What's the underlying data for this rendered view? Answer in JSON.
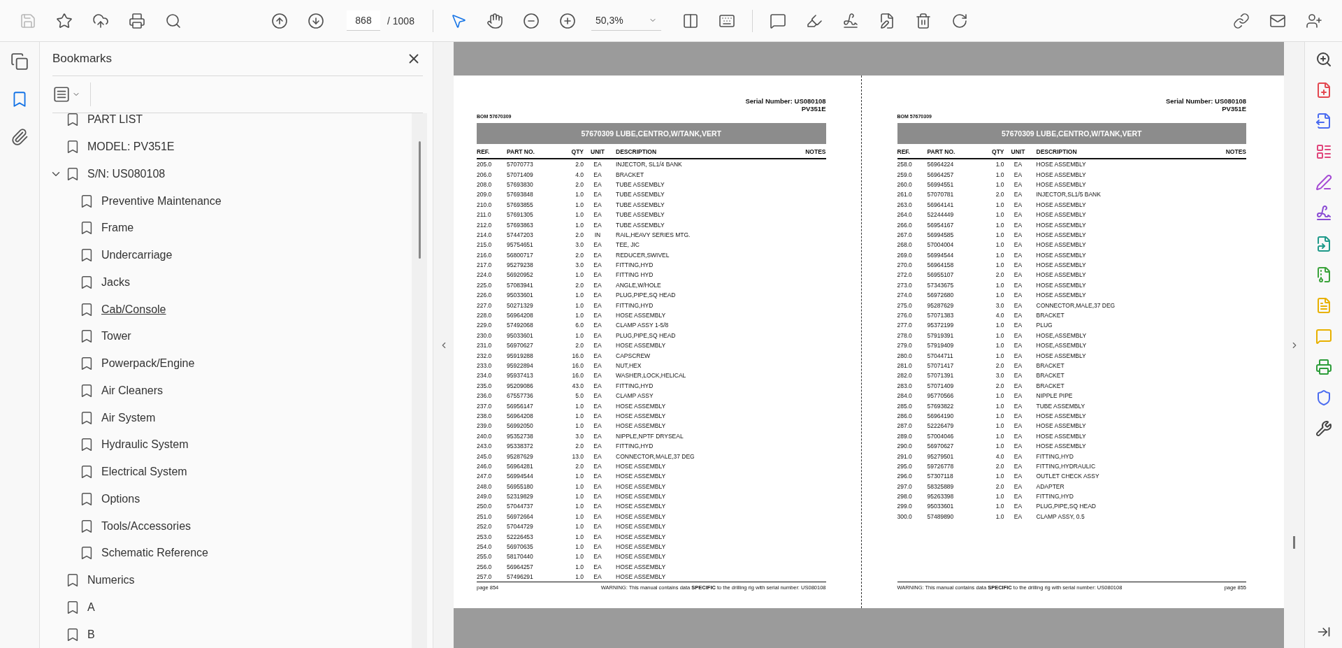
{
  "toolbar": {
    "save": {
      "disabled": true
    },
    "page_number": "868",
    "page_total": "/ 1008",
    "zoom": "50,3%",
    "tools": [
      {
        "kind": "select",
        "selected": true
      },
      {
        "kind": "hand",
        "selected": false
      }
    ]
  },
  "left_rail": [
    {
      "kind": "pages",
      "selected": false
    },
    {
      "kind": "bookmarks",
      "selected": true
    },
    {
      "kind": "attachments",
      "selected": false
    }
  ],
  "sidebar": {
    "title": "Bookmarks",
    "items": [
      {
        "label": "PART LIST",
        "hovered": false
      },
      {
        "label": "MODEL: PV351E",
        "hovered": false
      },
      {
        "label": "S/N: US080108",
        "hovered": false,
        "expanded": true,
        "children": [
          {
            "label": "Preventive Maintenance",
            "hovered": false
          },
          {
            "label": "Frame",
            "hovered": false
          },
          {
            "label": "Undercarriage",
            "hovered": false
          },
          {
            "label": "Jacks",
            "hovered": false
          },
          {
            "label": "Cab/Console",
            "hovered": true
          },
          {
            "label": "Tower",
            "hovered": false
          },
          {
            "label": "Powerpack/Engine",
            "hovered": false
          },
          {
            "label": "Air Cleaners",
            "hovered": false
          },
          {
            "label": "Air System",
            "hovered": false
          },
          {
            "label": "Hydraulic System",
            "hovered": false
          },
          {
            "label": "Electrical System",
            "hovered": false
          },
          {
            "label": "Options",
            "hovered": false
          },
          {
            "label": "Tools/Accessories",
            "hovered": false
          },
          {
            "label": "Schematic Reference",
            "hovered": false
          }
        ]
      },
      {
        "label": "Numerics",
        "hovered": false
      },
      {
        "label": "A",
        "hovered": false
      },
      {
        "label": "B",
        "hovered": false
      }
    ]
  },
  "pages": [
    {
      "serial": "Serial Number: US080108",
      "model": "PV351E",
      "bom": "BOM 57670309",
      "title": "57670309 LUBE,CENTRO,W/TANK,VERT",
      "columns": [
        "REF.",
        "PART NO.",
        "QTY",
        "UNIT",
        "DESCRIPTION",
        "NOTES"
      ],
      "rows": [
        [
          "205.0",
          "57070773",
          "2.0",
          "EA",
          "INJECTOR, SL1/4 BANK"
        ],
        [
          "206.0",
          "57071409",
          "4.0",
          "EA",
          "BRACKET"
        ],
        [
          "208.0",
          "57693830",
          "2.0",
          "EA",
          "TUBE ASSEMBLY"
        ],
        [
          "209.0",
          "57693848",
          "1.0",
          "EA",
          "TUBE ASSEMBLY"
        ],
        [
          "210.0",
          "57693855",
          "1.0",
          "EA",
          "TUBE ASSEMBLY"
        ],
        [
          "211.0",
          "57691305",
          "1.0",
          "EA",
          "TUBE ASSEMBLY"
        ],
        [
          "212.0",
          "57693863",
          "1.0",
          "EA",
          "TUBE ASSEMBLY"
        ],
        [
          "214.0",
          "57447203",
          "2.0",
          "IN",
          "RAIL,HEAVY SERIES MTG."
        ],
        [
          "215.0",
          "95754651",
          "3.0",
          "EA",
          "TEE, JIC"
        ],
        [
          "216.0",
          "56800717",
          "2.0",
          "EA",
          "REDUCER,SWIVEL"
        ],
        [
          "217.0",
          "95279238",
          "3.0",
          "EA",
          "FITTING,HYD"
        ],
        [
          "224.0",
          "56920952",
          "1.0",
          "EA",
          "FITTING HYD"
        ],
        [
          "225.0",
          "57083941",
          "2.0",
          "EA",
          "ANGLE,W/HOLE"
        ],
        [
          "226.0",
          "95033601",
          "1.0",
          "EA",
          "PLUG,PIPE,SQ HEAD"
        ],
        [
          "227.0",
          "50271329",
          "1.0",
          "EA",
          "FITTING,HYD"
        ],
        [
          "228.0",
          "56964208",
          "1.0",
          "EA",
          "HOSE ASSEMBLY"
        ],
        [
          "229.0",
          "57492068",
          "6.0",
          "EA",
          "CLAMP ASSY 1-5/8"
        ],
        [
          "230.0",
          "95033601",
          "1.0",
          "EA",
          "PLUG,PIPE,SQ HEAD"
        ],
        [
          "231.0",
          "56970627",
          "2.0",
          "EA",
          "HOSE ASSEMBLY"
        ],
        [
          "232.0",
          "95919288",
          "16.0",
          "EA",
          "CAPSCREW"
        ],
        [
          "233.0",
          "95922894",
          "16.0",
          "EA",
          "NUT,HEX"
        ],
        [
          "234.0",
          "95937413",
          "16.0",
          "EA",
          "WASHER,LOCK,HELICAL"
        ],
        [
          "235.0",
          "95209086",
          "43.0",
          "EA",
          "FITTING,HYD"
        ],
        [
          "236.0",
          "67557736",
          "5.0",
          "EA",
          "CLAMP ASSY"
        ],
        [
          "237.0",
          "56956147",
          "1.0",
          "EA",
          "HOSE ASSEMBLY"
        ],
        [
          "238.0",
          "56964208",
          "1.0",
          "EA",
          "HOSE ASSEMBLY"
        ],
        [
          "239.0",
          "56992050",
          "1.0",
          "EA",
          "HOSE ASSEMBLY"
        ],
        [
          "240.0",
          "95352738",
          "3.0",
          "EA",
          "NIPPLE,NPTF DRYSEAL"
        ],
        [
          "243.0",
          "95338372",
          "2.0",
          "EA",
          "FITTING,HYD"
        ],
        [
          "245.0",
          "95287629",
          "13.0",
          "EA",
          "CONNECTOR,MALE,37 DEG"
        ],
        [
          "246.0",
          "56964281",
          "2.0",
          "EA",
          "HOSE ASSEMBLY"
        ],
        [
          "247.0",
          "56994544",
          "1.0",
          "EA",
          "HOSE ASSEMBLY"
        ],
        [
          "248.0",
          "56955180",
          "1.0",
          "EA",
          "HOSE ASSEMBLY"
        ],
        [
          "249.0",
          "52319829",
          "1.0",
          "EA",
          "HOSE ASSEMBLY"
        ],
        [
          "250.0",
          "57044737",
          "1.0",
          "EA",
          "HOSE ASSEMBLY"
        ],
        [
          "251.0",
          "56972664",
          "1.0",
          "EA",
          "HOSE ASSEMBLY"
        ],
        [
          "252.0",
          "57044729",
          "1.0",
          "EA",
          "HOSE ASSEMBLY"
        ],
        [
          "253.0",
          "52226453",
          "1.0",
          "EA",
          "HOSE ASSEMBLY"
        ],
        [
          "254.0",
          "56970635",
          "1.0",
          "EA",
          "HOSE ASSEMBLY"
        ],
        [
          "255.0",
          "58170440",
          "1.0",
          "EA",
          "HOSE ASSEMBLY"
        ],
        [
          "256.0",
          "56964257",
          "1.0",
          "EA",
          "HOSE ASSEMBLY"
        ],
        [
          "257.0",
          "57496291",
          "1.0",
          "EA",
          "HOSE ASSEMBLY"
        ]
      ],
      "page_label": "page 854",
      "warning": "WARNING:  This manual contains data **SPECIFIC** to the drilling rig with serial number: US080108"
    },
    {
      "serial": "Serial Number: US080108",
      "model": "PV351E",
      "bom": "BOM 57670309",
      "title": "57670309 LUBE,CENTRO,W/TANK,VERT",
      "columns": [
        "REF.",
        "PART NO.",
        "QTY",
        "UNIT",
        "DESCRIPTION",
        "NOTES"
      ],
      "rows": [
        [
          "258.0",
          "56964224",
          "1.0",
          "EA",
          "HOSE ASSEMBLY"
        ],
        [
          "259.0",
          "56964257",
          "1.0",
          "EA",
          "HOSE ASSEMBLY"
        ],
        [
          "260.0",
          "56994551",
          "1.0",
          "EA",
          "HOSE ASSEMBLY"
        ],
        [
          "261.0",
          "57070781",
          "2.0",
          "EA",
          "INJECTOR,SL1/5 BANK"
        ],
        [
          "263.0",
          "56964141",
          "1.0",
          "EA",
          "HOSE ASSEMBLY"
        ],
        [
          "264.0",
          "52244449",
          "1.0",
          "EA",
          "HOSE ASSEMBLY"
        ],
        [
          "266.0",
          "56954167",
          "1.0",
          "EA",
          "HOSE ASSEMBLY"
        ],
        [
          "267.0",
          "56994585",
          "1.0",
          "EA",
          "HOSE ASSEMBLY"
        ],
        [
          "268.0",
          "57004004",
          "1.0",
          "EA",
          "HOSE ASSEMBLY"
        ],
        [
          "269.0",
          "56994544",
          "1.0",
          "EA",
          "HOSE ASSEMBLY"
        ],
        [
          "270.0",
          "56964158",
          "1.0",
          "EA",
          "HOSE ASSEMBLY"
        ],
        [
          "272.0",
          "56955107",
          "2.0",
          "EA",
          "HOSE ASSEMBLY"
        ],
        [
          "273.0",
          "57343675",
          "1.0",
          "EA",
          "HOSE ASSEMBLY"
        ],
        [
          "274.0",
          "56972680",
          "1.0",
          "EA",
          "HOSE ASSEMBLY"
        ],
        [
          "275.0",
          "95287629",
          "3.0",
          "EA",
          "CONNECTOR,MALE,37 DEG"
        ],
        [
          "276.0",
          "57071383",
          "4.0",
          "EA",
          "BRACKET"
        ],
        [
          "277.0",
          "95372199",
          "1.0",
          "EA",
          "PLUG"
        ],
        [
          "278.0",
          "57919391",
          "1.0",
          "EA",
          "HOSE,ASSEMBLY"
        ],
        [
          "279.0",
          "57919409",
          "1.0",
          "EA",
          "HOSE,ASSEMBLY"
        ],
        [
          "280.0",
          "57044711",
          "1.0",
          "EA",
          "HOSE ASSEMBLY"
        ],
        [
          "281.0",
          "57071417",
          "2.0",
          "EA",
          "BRACKET"
        ],
        [
          "282.0",
          "57071391",
          "3.0",
          "EA",
          "BRACKET"
        ],
        [
          "283.0",
          "57071409",
          "2.0",
          "EA",
          "BRACKET"
        ],
        [
          "284.0",
          "95770566",
          "1.0",
          "EA",
          "NIPPLE PIPE"
        ],
        [
          "285.0",
          "57693822",
          "1.0",
          "EA",
          "TUBE ASSEMBLY"
        ],
        [
          "286.0",
          "56964190",
          "1.0",
          "EA",
          "HOSE ASSEMBLY"
        ],
        [
          "287.0",
          "52226479",
          "1.0",
          "EA",
          "HOSE ASSEMBLY"
        ],
        [
          "289.0",
          "57004046",
          "1.0",
          "EA",
          "HOSE ASSEMBLY"
        ],
        [
          "290.0",
          "56970627",
          "1.0",
          "EA",
          "HOSE ASSEMBLY"
        ],
        [
          "291.0",
          "95279501",
          "4.0",
          "EA",
          "FITTING,HYD"
        ],
        [
          "295.0",
          "59726778",
          "2.0",
          "EA",
          "FITTING,HYDRAULIC"
        ],
        [
          "296.0",
          "57307118",
          "1.0",
          "EA",
          "OUTLET CHECK ASSY"
        ],
        [
          "297.0",
          "58325889",
          "2.0",
          "EA",
          "ADAPTER"
        ],
        [
          "298.0",
          "95263398",
          "1.0",
          "EA",
          "FITTING,HYD"
        ],
        [
          "299.0",
          "95033601",
          "1.0",
          "EA",
          "PLUG,PIPE,SQ HEAD"
        ],
        [
          "300.0",
          "57489890",
          "1.0",
          "EA",
          "CLAMP ASSY, 0.5"
        ]
      ],
      "page_label": "page 855",
      "warning": "WARNING:  This manual contains data **SPECIFIC** to the drilling rig with serial number: US080108"
    }
  ]
}
